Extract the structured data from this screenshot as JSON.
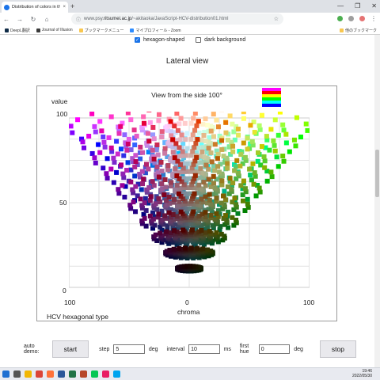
{
  "browser": {
    "tab_title": "Distribution of colors in the HC",
    "tab_close": "×",
    "new_tab": "+",
    "url_prefix": "www.psy.",
    "url_domain": "ritsumei.ac.jp",
    "url_path": "/~akitaoka/JavaScript-HCV-distribution01.html",
    "window_buttons": [
      "—",
      "❐",
      "✕"
    ],
    "bookmarks": [
      "DeepL翻訳",
      "Journal of Illusion",
      "ブックマークメニュー",
      "マイプロフィール - Zoom"
    ],
    "other_bookmarks": "他のブックマーク"
  },
  "options": {
    "hexagon_label": "hexagon-shaped",
    "hexagon_checked": true,
    "dark_label": "dark background",
    "dark_checked": false
  },
  "section_title": "Lateral view",
  "plot": {
    "title": "View from the side 100°",
    "ylabel": "value",
    "xlabel": "chroma",
    "footer": "HCV hexagonal type",
    "yticks": [
      "100",
      "50",
      "0"
    ],
    "xticks": [
      "100",
      "0",
      "100"
    ],
    "legend_colors": [
      "#ff00ff",
      "#ff0000",
      "#ffff00",
      "#00ff00",
      "#00ffff",
      "#0000ff"
    ]
  },
  "chart_data": {
    "type": "scatter",
    "title": "View from the side 100°",
    "xlabel": "chroma",
    "ylabel": "value",
    "ylim": [
      0,
      100
    ],
    "grid": true
  },
  "controls": {
    "auto_demo_label": "auto demo:",
    "start_label": "start",
    "step_label": "step",
    "step_value": "5",
    "step_unit": "deg",
    "interval_label": "interval",
    "interval_value": "10",
    "interval_unit": "ms",
    "first_hue_label": "first hue",
    "first_hue_value": "0",
    "first_hue_unit": "deg",
    "stop_label": "stop"
  },
  "taskbar": {
    "time": "19:46",
    "date": "2022/05/30"
  }
}
